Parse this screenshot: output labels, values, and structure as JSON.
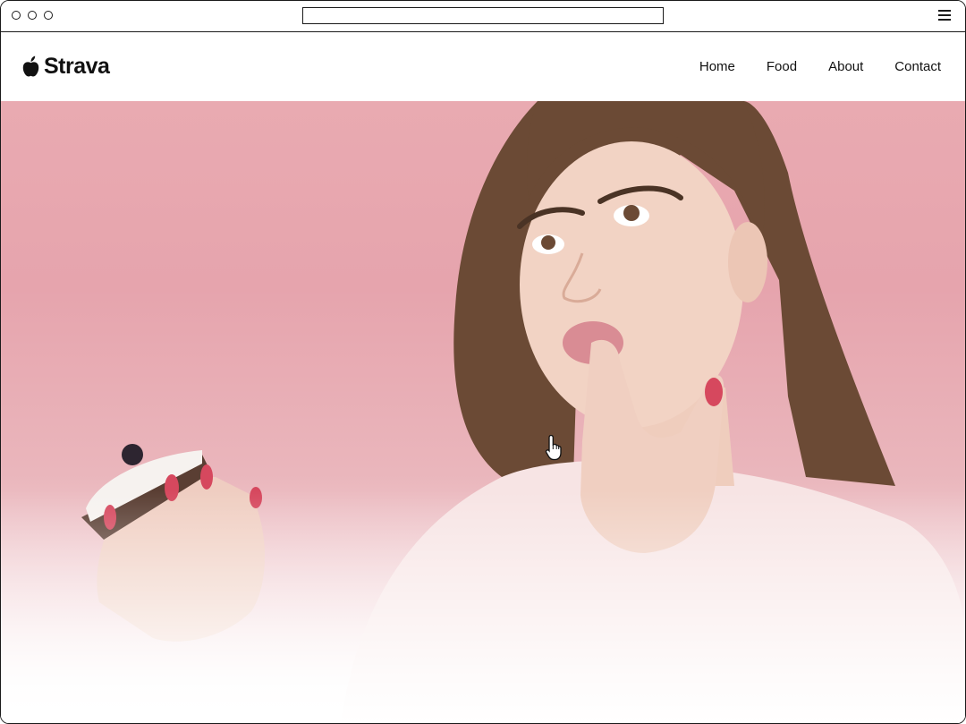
{
  "brand": {
    "name": "Strava",
    "logo_icon": "apple-icon"
  },
  "nav": {
    "items": [
      "Home",
      "Food",
      "About",
      "Contact"
    ]
  },
  "hero": {
    "image": "woman-licking-finger-holding-cake-photo",
    "background_color": "#e9aab1"
  },
  "colors": {
    "nail": "#d6485e",
    "hair": "#6b4a35",
    "skin": "#f2d3c4",
    "shirt": "#f7e4e4"
  }
}
